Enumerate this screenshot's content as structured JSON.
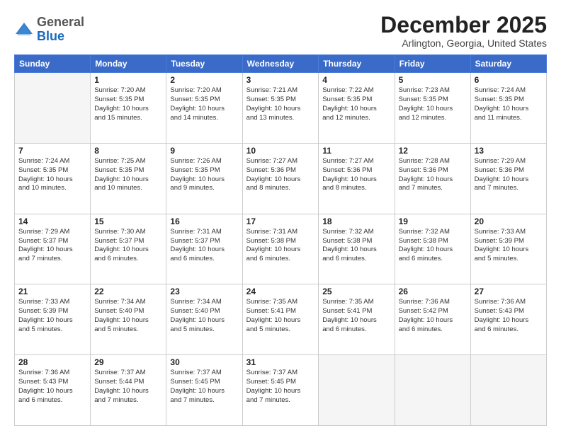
{
  "logo": {
    "general": "General",
    "blue": "Blue"
  },
  "header": {
    "month": "December 2025",
    "location": "Arlington, Georgia, United States"
  },
  "weekdays": [
    "Sunday",
    "Monday",
    "Tuesday",
    "Wednesday",
    "Thursday",
    "Friday",
    "Saturday"
  ],
  "weeks": [
    [
      {
        "day": "",
        "info": ""
      },
      {
        "day": "1",
        "info": "Sunrise: 7:20 AM\nSunset: 5:35 PM\nDaylight: 10 hours\nand 15 minutes."
      },
      {
        "day": "2",
        "info": "Sunrise: 7:20 AM\nSunset: 5:35 PM\nDaylight: 10 hours\nand 14 minutes."
      },
      {
        "day": "3",
        "info": "Sunrise: 7:21 AM\nSunset: 5:35 PM\nDaylight: 10 hours\nand 13 minutes."
      },
      {
        "day": "4",
        "info": "Sunrise: 7:22 AM\nSunset: 5:35 PM\nDaylight: 10 hours\nand 12 minutes."
      },
      {
        "day": "5",
        "info": "Sunrise: 7:23 AM\nSunset: 5:35 PM\nDaylight: 10 hours\nand 12 minutes."
      },
      {
        "day": "6",
        "info": "Sunrise: 7:24 AM\nSunset: 5:35 PM\nDaylight: 10 hours\nand 11 minutes."
      }
    ],
    [
      {
        "day": "7",
        "info": "Sunrise: 7:24 AM\nSunset: 5:35 PM\nDaylight: 10 hours\nand 10 minutes."
      },
      {
        "day": "8",
        "info": "Sunrise: 7:25 AM\nSunset: 5:35 PM\nDaylight: 10 hours\nand 10 minutes."
      },
      {
        "day": "9",
        "info": "Sunrise: 7:26 AM\nSunset: 5:35 PM\nDaylight: 10 hours\nand 9 minutes."
      },
      {
        "day": "10",
        "info": "Sunrise: 7:27 AM\nSunset: 5:36 PM\nDaylight: 10 hours\nand 8 minutes."
      },
      {
        "day": "11",
        "info": "Sunrise: 7:27 AM\nSunset: 5:36 PM\nDaylight: 10 hours\nand 8 minutes."
      },
      {
        "day": "12",
        "info": "Sunrise: 7:28 AM\nSunset: 5:36 PM\nDaylight: 10 hours\nand 7 minutes."
      },
      {
        "day": "13",
        "info": "Sunrise: 7:29 AM\nSunset: 5:36 PM\nDaylight: 10 hours\nand 7 minutes."
      }
    ],
    [
      {
        "day": "14",
        "info": "Sunrise: 7:29 AM\nSunset: 5:37 PM\nDaylight: 10 hours\nand 7 minutes."
      },
      {
        "day": "15",
        "info": "Sunrise: 7:30 AM\nSunset: 5:37 PM\nDaylight: 10 hours\nand 6 minutes."
      },
      {
        "day": "16",
        "info": "Sunrise: 7:31 AM\nSunset: 5:37 PM\nDaylight: 10 hours\nand 6 minutes."
      },
      {
        "day": "17",
        "info": "Sunrise: 7:31 AM\nSunset: 5:38 PM\nDaylight: 10 hours\nand 6 minutes."
      },
      {
        "day": "18",
        "info": "Sunrise: 7:32 AM\nSunset: 5:38 PM\nDaylight: 10 hours\nand 6 minutes."
      },
      {
        "day": "19",
        "info": "Sunrise: 7:32 AM\nSunset: 5:38 PM\nDaylight: 10 hours\nand 6 minutes."
      },
      {
        "day": "20",
        "info": "Sunrise: 7:33 AM\nSunset: 5:39 PM\nDaylight: 10 hours\nand 5 minutes."
      }
    ],
    [
      {
        "day": "21",
        "info": "Sunrise: 7:33 AM\nSunset: 5:39 PM\nDaylight: 10 hours\nand 5 minutes."
      },
      {
        "day": "22",
        "info": "Sunrise: 7:34 AM\nSunset: 5:40 PM\nDaylight: 10 hours\nand 5 minutes."
      },
      {
        "day": "23",
        "info": "Sunrise: 7:34 AM\nSunset: 5:40 PM\nDaylight: 10 hours\nand 5 minutes."
      },
      {
        "day": "24",
        "info": "Sunrise: 7:35 AM\nSunset: 5:41 PM\nDaylight: 10 hours\nand 5 minutes."
      },
      {
        "day": "25",
        "info": "Sunrise: 7:35 AM\nSunset: 5:41 PM\nDaylight: 10 hours\nand 6 minutes."
      },
      {
        "day": "26",
        "info": "Sunrise: 7:36 AM\nSunset: 5:42 PM\nDaylight: 10 hours\nand 6 minutes."
      },
      {
        "day": "27",
        "info": "Sunrise: 7:36 AM\nSunset: 5:43 PM\nDaylight: 10 hours\nand 6 minutes."
      }
    ],
    [
      {
        "day": "28",
        "info": "Sunrise: 7:36 AM\nSunset: 5:43 PM\nDaylight: 10 hours\nand 6 minutes."
      },
      {
        "day": "29",
        "info": "Sunrise: 7:37 AM\nSunset: 5:44 PM\nDaylight: 10 hours\nand 7 minutes."
      },
      {
        "day": "30",
        "info": "Sunrise: 7:37 AM\nSunset: 5:45 PM\nDaylight: 10 hours\nand 7 minutes."
      },
      {
        "day": "31",
        "info": "Sunrise: 7:37 AM\nSunset: 5:45 PM\nDaylight: 10 hours\nand 7 minutes."
      },
      {
        "day": "",
        "info": ""
      },
      {
        "day": "",
        "info": ""
      },
      {
        "day": "",
        "info": ""
      }
    ]
  ]
}
